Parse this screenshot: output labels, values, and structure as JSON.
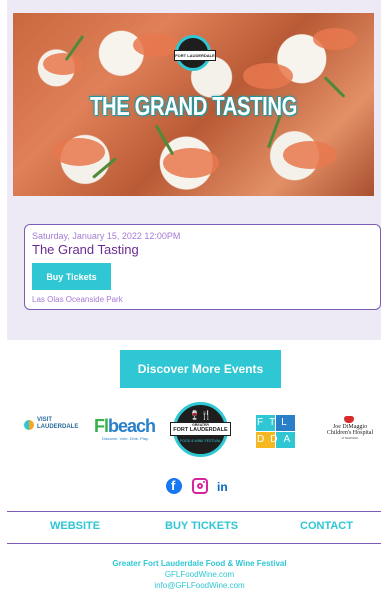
{
  "hero": {
    "title": "THE GRAND TASTING",
    "logo_text": "FORT LAUDERDALE"
  },
  "event": {
    "date": "Saturday, January 15, 2022 12:00PM",
    "title": "The Grand Tasting",
    "buy_label": "Buy Tickets",
    "venue": "Las Olas Oceanside Park"
  },
  "discover_label": "Discover More Events",
  "sponsors": {
    "visit": {
      "line1": "VISIT",
      "line2": "LAUDERDALE"
    },
    "flbeach": {
      "fl": "Fl",
      "beach": "beach",
      "tagline": "Discover. Vote. Dine. Play."
    },
    "gfl": {
      "top": "GREATER",
      "main": "FORT LAUDERDALE",
      "sub": "FOOD & WINE FESTIVAL"
    },
    "ftl": {
      "row1": "FTL",
      "row2": "DDA"
    },
    "joe": {
      "line1": "Joe DiMaggio",
      "line2": "Children's Hospital",
      "line3": "AT MEMORIAL"
    }
  },
  "social": {
    "facebook": "f",
    "linkedin": "in"
  },
  "nav": {
    "website": "WEBSITE",
    "buy_tickets": "BUY TICKETS",
    "contact": "CONTACT"
  },
  "footer": {
    "org": "Greater Fort Lauderdale Food & Wine Festival",
    "site": "GFLFoodWine.com",
    "email": "info@GFLFoodWine.com"
  },
  "colors": {
    "accent": "#2fc7d3",
    "purple": "#6b2c91",
    "lavender": "#a77bd6",
    "card_bg": "#edeaf5"
  }
}
